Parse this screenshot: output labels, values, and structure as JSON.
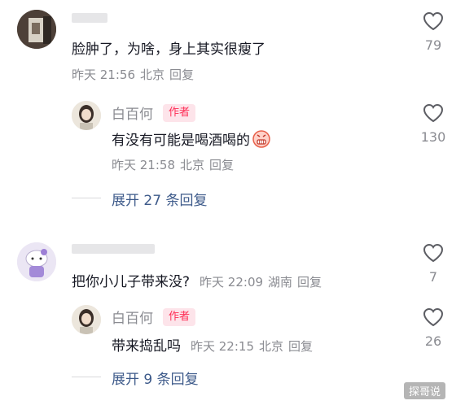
{
  "comments": [
    {
      "text": "脸肿了，为啥，身上其实很瘦了",
      "time": "昨天 21:56",
      "location": "北京",
      "reply_label": "回复",
      "likes": "79",
      "reply": {
        "author": "白百何",
        "badge": "作者",
        "text": "有没有可能是喝酒喝的",
        "time": "昨天 21:58",
        "location": "北京",
        "reply_label": "回复",
        "likes": "130"
      },
      "expand_label": "展开 27 条回复"
    },
    {
      "text": "把你小儿子带来没?",
      "time": "昨天 22:09",
      "location": "湖南",
      "reply_label": "回复",
      "likes": "7",
      "reply": {
        "author": "白百何",
        "badge": "作者",
        "text": "带来捣乱吗",
        "time": "昨天 22:15",
        "location": "北京",
        "reply_label": "回复",
        "likes": "26"
      },
      "expand_label": "展开 9 条回复"
    }
  ],
  "watermark": "探哥说",
  "icons": {
    "like": "heart-outline-icon",
    "emoji": "grimace-face-icon"
  },
  "colors": {
    "author_badge": "#fe2c55",
    "expand_link": "#3d5a8a",
    "meta": "#8a8b91"
  }
}
